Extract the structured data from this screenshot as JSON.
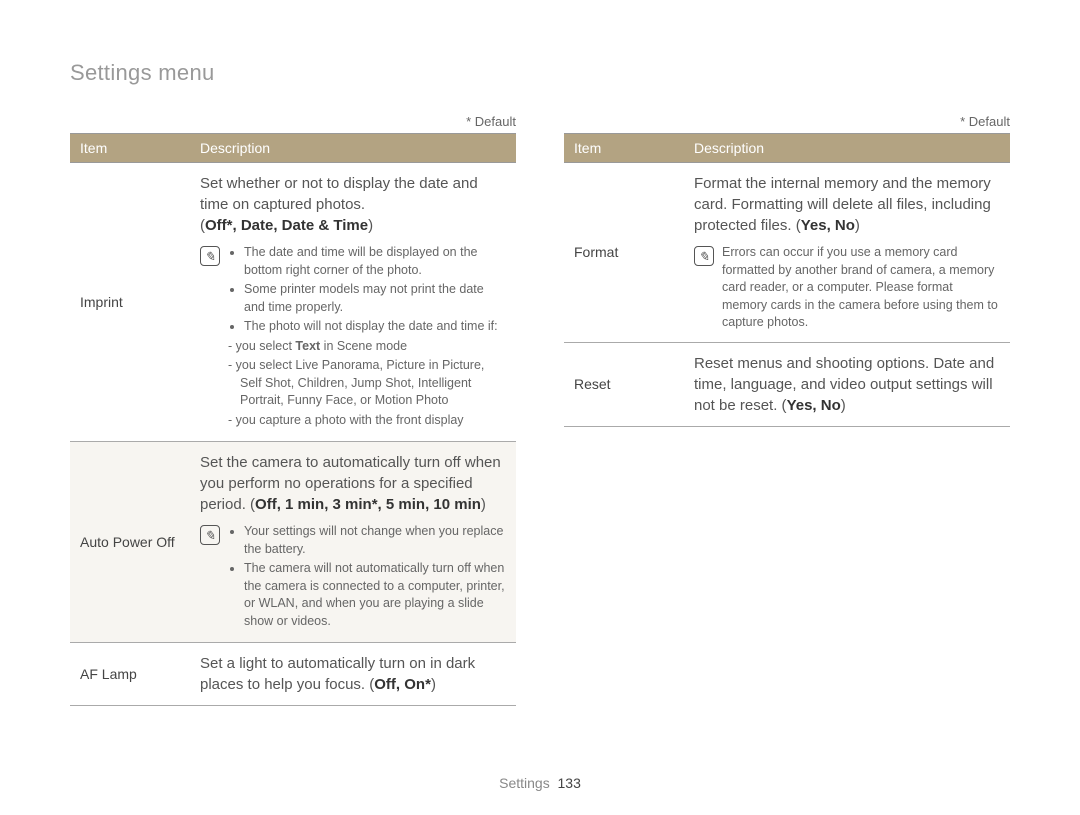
{
  "page_title": "Settings menu",
  "default_label": "* Default",
  "table_headers": {
    "item": "Item",
    "description": "Description"
  },
  "note_glyph": "✎",
  "footer": {
    "section": "Settings",
    "page": "133"
  },
  "left": {
    "rows": [
      {
        "item": "Imprint",
        "desc_intro": "Set whether or not to display the date and time on captured photos.",
        "desc_options_prefix": "(",
        "desc_options": "Off*, Date, Date & Time",
        "desc_options_suffix": ")",
        "notes": [
          "The date and time will be displayed on the bottom right corner of the photo.",
          "Some printer models may not print the date and time properly.",
          "The photo will not display the date and time if:"
        ],
        "subnotes": [
          "you select Text in Scene mode",
          "you select Live Panorama, Picture in Picture, Self Shot, Children, Jump Shot, Intelligent Portrait, Funny Face, or Motion Photo",
          "you capture a photo with the front display"
        ],
        "subnote_bold_word": "Text"
      },
      {
        "item": "Auto Power Off",
        "desc_intro": "Set the camera to automatically turn off when you perform no operations for a specified period. (",
        "desc_options": "Off, 1 min, 3 min*, 5 min, 10 min",
        "desc_options_suffix": ")",
        "notes": [
          "Your settings will not change when you replace the battery.",
          "The camera will not automatically turn off when the camera is connected to a computer, printer, or WLAN, and when you are playing a slide show or videos."
        ]
      },
      {
        "item": "AF Lamp",
        "desc_intro": "Set a light to automatically turn on in dark places to help you focus. (",
        "desc_options": "Off, On*",
        "desc_options_suffix": ")"
      }
    ]
  },
  "right": {
    "rows": [
      {
        "item": "Format",
        "desc_intro": "Format the internal memory and the memory card. Formatting will delete all files, including protected files. (",
        "desc_options": "Yes, No",
        "desc_options_suffix": ")",
        "note_text": "Errors can occur if you use a memory card formatted by another brand of camera, a memory card reader, or a computer. Please format memory cards in the camera before using them to capture photos."
      },
      {
        "item": "Reset",
        "desc_intro": "Reset menus and shooting options. Date and time, language, and video output settings will not be reset. (",
        "desc_options": "Yes, No",
        "desc_options_suffix": ")"
      }
    ]
  }
}
